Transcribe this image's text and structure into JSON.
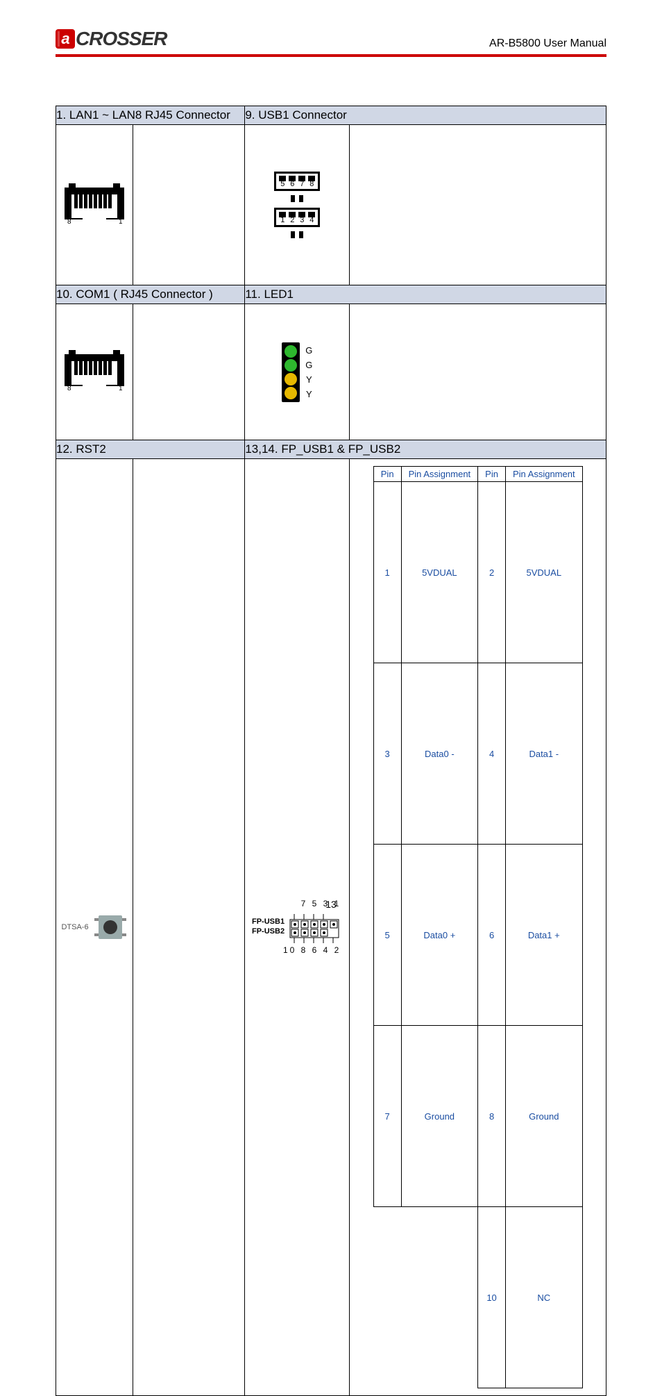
{
  "header": {
    "logo_badge": "a",
    "logo_text": "CROSSER",
    "doc_title": "AR-B5800 User Manual"
  },
  "sections": {
    "s1": "1. LAN1 ~ LAN8 RJ45 Connector",
    "s9": "9. USB1 Connector",
    "s10": "10. COM1 ( RJ45 Connector )",
    "s11": "11. LED1",
    "s12": "12. RST2",
    "s13": "13,14. FP_USB1 & FP_USB2"
  },
  "rj45": {
    "left_num": "8",
    "right_num": "1"
  },
  "usb_conn": {
    "top_nums": [
      "5",
      "6",
      "7",
      "8"
    ],
    "bot_nums": [
      "1",
      "2",
      "3",
      "4"
    ]
  },
  "led": {
    "labels": [
      "G",
      "G",
      "Y",
      "Y"
    ]
  },
  "rst": {
    "label": "DTSA-6"
  },
  "fpusb": {
    "top_nums": "7 5 3 1",
    "bot_nums": "10 8 6 4 2",
    "label1": "FP-USB1",
    "label2": "FP-USB2"
  },
  "pin_table": {
    "headers": [
      "Pin",
      "Pin Assignment",
      "Pin",
      "Pin Assignment"
    ],
    "rows": [
      [
        "1",
        "5VDUAL",
        "2",
        "5VDUAL"
      ],
      [
        "3",
        "Data0 -",
        "4",
        "Data1 -"
      ],
      [
        "5",
        "Data0 +",
        "6",
        "Data1 +"
      ],
      [
        "7",
        "Ground",
        "8",
        "Ground"
      ],
      [
        "",
        "",
        "10",
        "NC"
      ]
    ]
  },
  "page_number": "13"
}
